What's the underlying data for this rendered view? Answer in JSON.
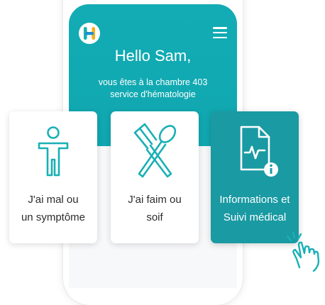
{
  "colors": {
    "primary": "#13acb4",
    "active_card": "#1a9aa3",
    "background": "#ffffff"
  },
  "header": {
    "logo_letter": "H",
    "menu_icon": "hamburger-menu-icon",
    "greeting": "Hello Sam,",
    "subtitle_line1": "vous êtes à la chambre 403",
    "subtitle_line2": "service d'hématologie"
  },
  "cards": [
    {
      "icon": "person-body-icon",
      "line1": "J'ai mal ou",
      "line2": "un symptôme"
    },
    {
      "icon": "fork-spoon-icon",
      "line1": "J'ai faim ou",
      "line2": "soif"
    },
    {
      "icon": "medical-document-info-icon",
      "line1": "Informations et",
      "line2": "Suivi médical"
    }
  ]
}
